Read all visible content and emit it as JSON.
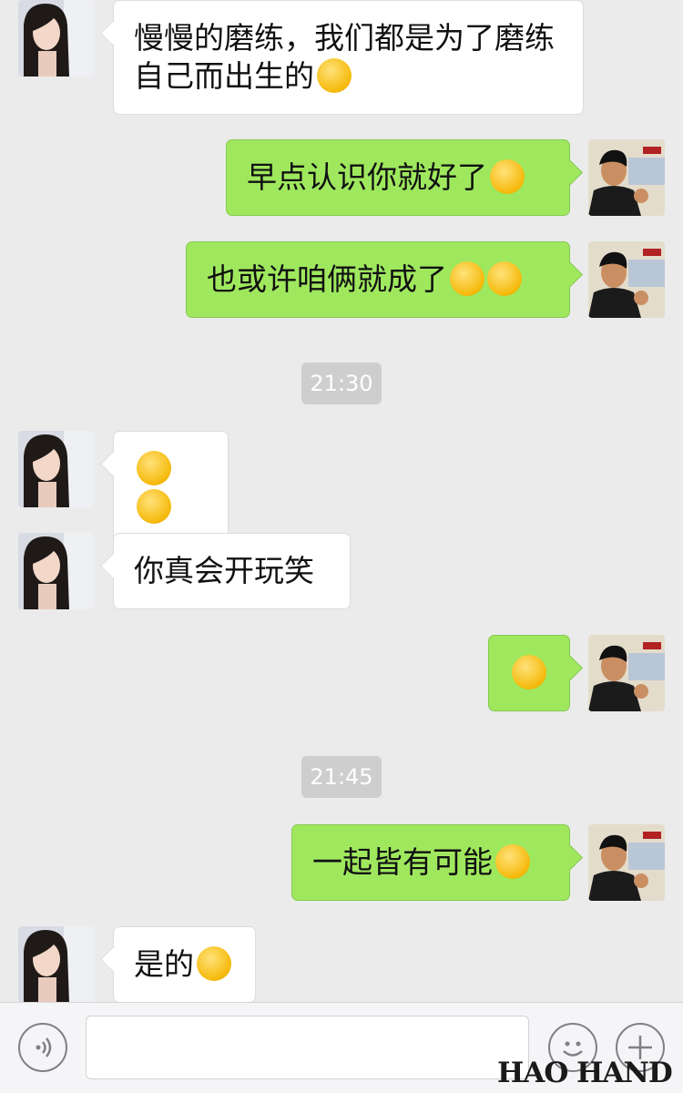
{
  "messages": [
    {
      "side": "left",
      "text": "慢慢的磨练，我们都是为了磨练自己而出生的",
      "emojis": [
        "grin-emoji"
      ]
    },
    {
      "side": "right",
      "text": "早点认识你就好了",
      "emojis": [
        "facepalm-emoji"
      ]
    },
    {
      "side": "right",
      "text": "也或许咱俩就成了",
      "emojis": [
        "grin-emoji",
        "grin-emoji"
      ]
    },
    {
      "time": "21:30"
    },
    {
      "side": "left",
      "text": "",
      "emojis": [
        "facepalm-emoji",
        "facepalm-emoji"
      ]
    },
    {
      "side": "left",
      "text": "你真会开玩笑",
      "emojis": []
    },
    {
      "side": "right",
      "text": "",
      "emojis": [
        "wink-tongue-emoji"
      ]
    },
    {
      "time": "21:45"
    },
    {
      "side": "right",
      "text": "一起皆有可能",
      "emojis": [
        "grin-emoji"
      ]
    },
    {
      "side": "left",
      "text": "是的",
      "emojis": [
        "grin-emoji"
      ]
    }
  ],
  "input_bar": {
    "voice_icon": "voice-icon",
    "emoji_icon": "emoji-icon",
    "plus_icon": "plus-icon",
    "text_value": ""
  },
  "watermark": {
    "logo_text": "HAO HAND"
  },
  "colors": {
    "background": "#ebebeb",
    "sent_bubble": "#9fe85e",
    "received_bubble": "#ffffff",
    "timestamp_bg": "#cecece"
  }
}
